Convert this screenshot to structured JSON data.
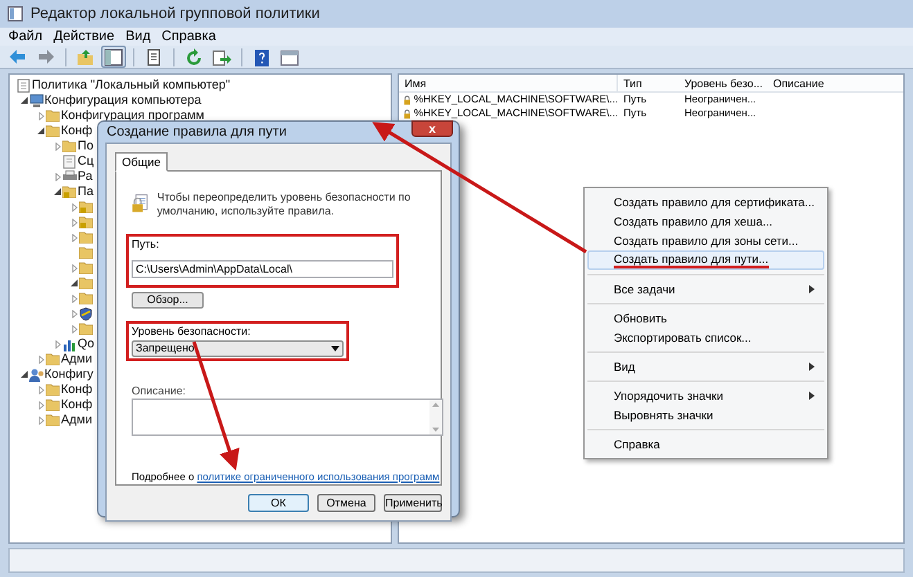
{
  "window": {
    "title": "Редактор локальной групповой политики"
  },
  "menu": [
    "Файл",
    "Действие",
    "Вид",
    "Справка"
  ],
  "toolbar": [
    {
      "kind": "back"
    },
    {
      "kind": "forward"
    },
    {
      "kind": "sep"
    },
    {
      "kind": "up"
    },
    {
      "kind": "tree",
      "selected": true
    },
    {
      "kind": "sep"
    },
    {
      "kind": "props"
    },
    {
      "kind": "sep"
    },
    {
      "kind": "refresh"
    },
    {
      "kind": "export"
    },
    {
      "kind": "sep"
    },
    {
      "kind": "help"
    },
    {
      "kind": "pane"
    }
  ],
  "tree": [
    {
      "label": "Политика \"Локальный компьютер\"",
      "kind": "policy",
      "children": [
        {
          "label": "Конфигурация компьютера",
          "kind": "computer",
          "expanded": true,
          "children": [
            {
              "label": "Конфигурация программ",
              "kind": "folder",
              "expanded": false
            },
            {
              "label": "Конф",
              "kind": "folder",
              "expanded": true,
              "children": [
                {
                  "label": "По",
                  "kind": "folder",
                  "expanded": false
                },
                {
                  "label": "Сц",
                  "kind": "script"
                },
                {
                  "label": "Ра",
                  "kind": "printer",
                  "expanded": false
                },
                {
                  "label": "Па",
                  "kind": "lock-folder",
                  "expanded": true,
                  "children": [
                    {
                      "kind": "lock-folder",
                      "expanded": false
                    },
                    {
                      "kind": "lock-folder",
                      "expanded": false
                    },
                    {
                      "kind": "folder",
                      "expanded": false
                    },
                    {
                      "kind": "folder"
                    },
                    {
                      "kind": "folder",
                      "expanded": false
                    },
                    {
                      "kind": "folder",
                      "expanded": true
                    },
                    {
                      "kind": "folder",
                      "expanded": false
                    },
                    {
                      "kind": "shield",
                      "expanded": false
                    },
                    {
                      "kind": "folder",
                      "expanded": false
                    }
                  ]
                },
                {
                  "label": "Qo",
                  "kind": "chart",
                  "expanded": false
                }
              ]
            },
            {
              "label": "Адми",
              "kind": "folder",
              "expanded": false
            }
          ]
        },
        {
          "label": "Конфигу",
          "kind": "user",
          "expanded": true,
          "children": [
            {
              "label": "Конф",
              "kind": "folder",
              "expanded": false
            },
            {
              "label": "Конф",
              "kind": "folder",
              "expanded": false
            },
            {
              "label": "Адми",
              "kind": "folder",
              "expanded": false
            }
          ]
        }
      ]
    }
  ],
  "list": {
    "columns": [
      "Имя",
      "Тип",
      "Уровень безо...",
      "Описание"
    ],
    "rows": [
      [
        "%HKEY_LOCAL_MACHINE\\SOFTWARE\\...",
        "Путь",
        "Неограничен..."
      ],
      [
        "%HKEY_LOCAL_MACHINE\\SOFTWARE\\...",
        "Путь",
        "Неограничен..."
      ]
    ]
  },
  "context_menu": [
    [
      {
        "label": "Создать правило для сертификата...",
        "selected": false
      },
      {
        "label": "Создать правило для хеша...",
        "selected": false
      },
      {
        "label": "Создать правило для зоны сети...",
        "selected": false
      },
      {
        "label": "Создать правило для пути...",
        "selected": true
      }
    ],
    [
      {
        "label": "Все задачи",
        "submenu": true,
        "selected": false
      }
    ],
    [
      {
        "label": "Обновить",
        "selected": false
      },
      {
        "label": "Экспортировать список...",
        "selected": false
      }
    ],
    [
      {
        "label": "Вид",
        "submenu": true,
        "selected": false
      }
    ],
    [
      {
        "label": "Упорядочить значки",
        "submenu": true,
        "selected": false
      },
      {
        "label": "Выровнять значки",
        "selected": false
      }
    ],
    [
      {
        "label": "Справка",
        "selected": false
      }
    ]
  ],
  "dialog": {
    "title": "Создание правила для пути",
    "close": "x",
    "tabs": [
      {
        "label": "Общие",
        "selected": true
      }
    ],
    "info": "Чтобы переопределить уровень безопасности по умолчанию, используйте правила.",
    "path_label": "Путь:",
    "path_value": "C:\\Users\\Admin\\AppData\\Local\\",
    "browse": "Обзор...",
    "level_label": "Уровень безопасности:",
    "level_value": "Запрещено",
    "description_label": "Описание:",
    "more_text": "Подробнее о ",
    "more_link": "политике ограниченного использования программ",
    "buttons": [
      {
        "label": "ОК",
        "default": true
      },
      {
        "label": "Отмена",
        "default": false
      },
      {
        "label": "Применить",
        "default": false
      }
    ]
  }
}
